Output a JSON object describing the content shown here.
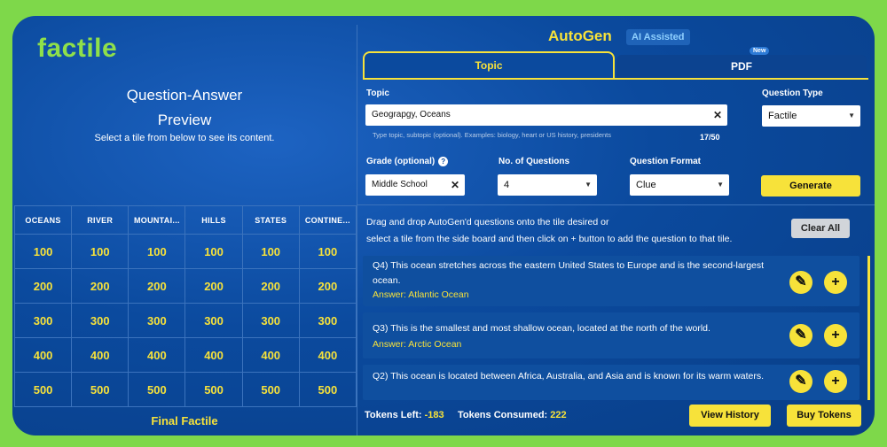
{
  "logo": "factile",
  "preview": {
    "title_line1": "Question-Answer",
    "title_line2": "Preview",
    "subtitle": "Select a tile from below to see its content."
  },
  "board": {
    "categories": [
      "OCEANS",
      "RIVER",
      "MOUNTAI...",
      "HILLS",
      "STATES",
      "CONTINE..."
    ],
    "values": [
      "100",
      "200",
      "300",
      "400",
      "500"
    ],
    "final": "Final Factile"
  },
  "autogen": {
    "title": "AutoGen",
    "badge": "AI Assisted",
    "tabs": {
      "topic": "Topic",
      "pdf": "PDF",
      "new_badge": "New"
    }
  },
  "form": {
    "topic_label": "Topic",
    "topic_value": "Geograpgy, Oceans",
    "topic_hint": "Type topic, subtopic (optional). Examples: biology, heart or US history, presidents",
    "topic_counter": "17/50",
    "question_type_label": "Question Type",
    "question_type_value": "Factile",
    "grade_label": "Grade (optional)",
    "grade_value": "Middle School",
    "num_questions_label": "No. of Questions",
    "num_questions_value": "4",
    "format_label": "Question Format",
    "format_value": "Clue",
    "generate": "Generate"
  },
  "results": {
    "instruction_line1": "Drag and drop AutoGen'd questions onto the tile desired or",
    "instruction_line2": "select a tile from the side board and then click on + button to add the question to that tile.",
    "clear_all": "Clear All",
    "questions": [
      {
        "text": "Q4) This ocean stretches across the eastern United States to Europe and is the second-largest ocean.",
        "answer": "Answer: Atlantic Ocean"
      },
      {
        "text": "Q3) This is the smallest and most shallow ocean, located at the north of the world.",
        "answer": "Answer: Arctic Ocean"
      },
      {
        "text": "Q2) This ocean is located between Africa, Australia, and Asia and is known for its warm waters.",
        "answer": ""
      }
    ]
  },
  "footer": {
    "tokens_left_label": "Tokens Left:",
    "tokens_left_value": "-183",
    "tokens_consumed_label": "Tokens Consumed:",
    "tokens_consumed_value": "222",
    "view_history": "View History",
    "buy_tokens": "Buy Tokens"
  },
  "colors": {
    "accent": "#f7e23a",
    "panel": "#0b4a9e",
    "logo": "#8fe04a",
    "background": "#7ed84a"
  },
  "icons": {
    "edit": "edit-icon",
    "add": "plus-icon",
    "help": "help-icon",
    "clear": "close-icon"
  }
}
